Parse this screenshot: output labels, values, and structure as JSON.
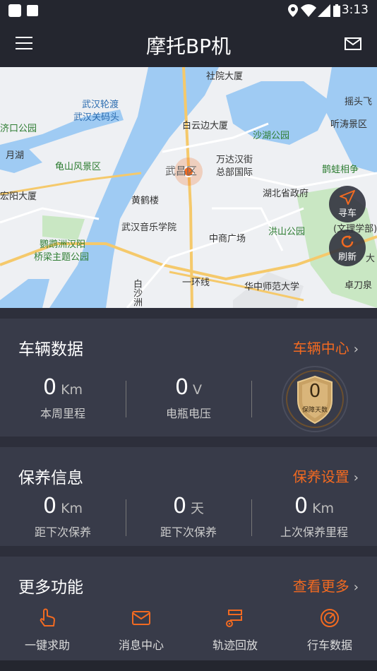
{
  "status_bar": {
    "time": "3:13"
  },
  "app_bar": {
    "title": "摩托BP机"
  },
  "map": {
    "labels": [
      "社院大厦",
      "武汉轮渡",
      "武汉关码头",
      "白云边大厦",
      "沙湖公园",
      "听涛景区",
      "摇头飞",
      "济口公园",
      "月湖",
      "龟山风景区",
      "万达汉街",
      "总部国际",
      "鹊蛙相争",
      "宏阳大厦",
      "黄鹤楼",
      "武昌区",
      "湖北省政府",
      "武汉音乐学院",
      "中商广场",
      "洪山公园",
      "鹦鹉洲汉阳",
      "桥梁主题公园",
      "一环线",
      "白沙洲",
      "华中师范大学",
      "卓刀泉",
      "(文理学部)",
      "大"
    ],
    "buttons": {
      "find_car": "寻车",
      "refresh": "刷新"
    }
  },
  "vehicle": {
    "title": "车辆数据",
    "link": "车辆中心",
    "stats": [
      {
        "value": "0",
        "unit": "Km",
        "label": "本周里程"
      },
      {
        "value": "0",
        "unit": "V",
        "label": "电瓶电压"
      }
    ],
    "badge": {
      "value": "0",
      "label": "保障天数"
    }
  },
  "maintenance": {
    "title": "保养信息",
    "link": "保养设置",
    "stats": [
      {
        "value": "0",
        "unit": "Km",
        "label": "距下次保养"
      },
      {
        "value": "0",
        "unit": "天",
        "label": "距下次保养"
      },
      {
        "value": "0",
        "unit": "Km",
        "label": "上次保养里程"
      }
    ]
  },
  "more": {
    "title": "更多功能",
    "link": "查看更多",
    "items": [
      {
        "label": "一键求助",
        "icon": "hand-tap-icon"
      },
      {
        "label": "消息中心",
        "icon": "mail-icon"
      },
      {
        "label": "轨迹回放",
        "icon": "route-icon"
      },
      {
        "label": "行车数据",
        "icon": "gauge-icon"
      }
    ]
  },
  "colors": {
    "accent": "#f26a21",
    "card": "#383b49",
    "background": "#2d2f3b",
    "bar": "#24262f"
  }
}
